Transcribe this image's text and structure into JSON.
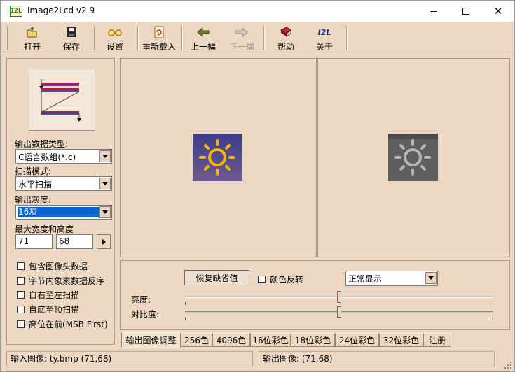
{
  "window": {
    "title": "Image2Lcd v2.9",
    "app_icon_text": "I2L"
  },
  "toolbar": {
    "open_label": "打开",
    "save_label": "保存",
    "settings_label": "设置",
    "reload_label": "重新载入",
    "prev_label": "上一幅",
    "next_label": "下一幅",
    "help_label": "帮助",
    "about_label": "关于",
    "about_icon_text": "I2L"
  },
  "left_panel": {
    "output_type_label": "输出数据类型:",
    "output_type_value": "C语言数组(*.c)",
    "scan_mode_label": "扫描模式:",
    "scan_mode_value": "水平扫描",
    "gray_label": "输出灰度:",
    "gray_value": "16灰",
    "max_size_label": "最大宽度和高度",
    "width_value": "71",
    "height_value": "68",
    "options": [
      {
        "label": "包含图像头数据",
        "checked": false
      },
      {
        "label": "字节内象素数据反序",
        "checked": false
      },
      {
        "label": "自右至左扫描",
        "checked": false
      },
      {
        "label": "自底至顶扫描",
        "checked": false
      },
      {
        "label": "高位在前(MSB First)",
        "checked": false
      }
    ]
  },
  "controls": {
    "restore_label": "恢复缺省值",
    "invert_label": "颜色反转",
    "display_mode_value": "正常显示",
    "brightness_label": "亮度:",
    "contrast_label": "对比度:",
    "brightness_level": 0.5,
    "contrast_level": 0.5
  },
  "tabs": [
    "输出图像调整",
    "256色",
    "4096色",
    "16位彩色",
    "18位彩色",
    "24位彩色",
    "32位彩色",
    "注册"
  ],
  "status": {
    "input_text": "输入图像: ty.bmp (71,68)",
    "output_text": "输出图像: (71,68)"
  },
  "colors": {
    "window_bg": "#ecd8c2",
    "input_icon_bg": "#5a4f8e",
    "sun_yellow": "#f5b800",
    "output_icon_bg": "#6a6a6a",
    "selection_blue": "#0a64d2"
  }
}
